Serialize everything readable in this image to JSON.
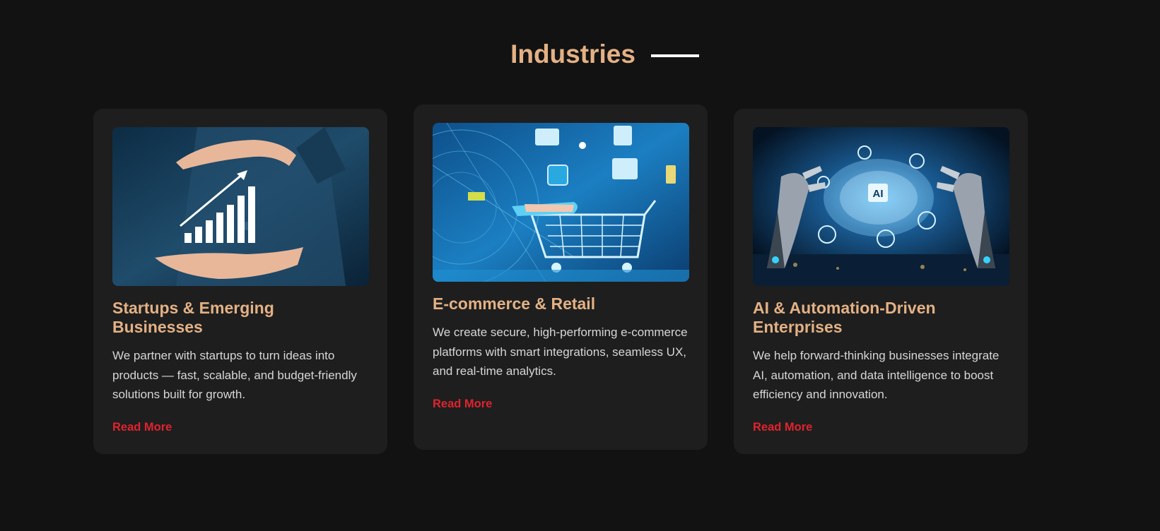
{
  "section": {
    "title": "Industries"
  },
  "cards": [
    {
      "title": "Startups & Emerging Businesses",
      "description": "We partner with startups to turn ideas into products — fast, scalable, and budget-friendly solutions built for growth.",
      "link": "Read More",
      "image_icon": "growth-chart-hands-image"
    },
    {
      "title": "E-commerce & Retail",
      "description": "We create secure, high-performing e-commerce platforms with smart integrations, seamless UX, and real-time analytics.",
      "link": "Read More",
      "image_icon": "shopping-cart-digital-image"
    },
    {
      "title": "AI & Automation-Driven Enterprises",
      "description": "We help forward-thinking businesses integrate AI, automation, and data intelligence to boost efficiency and innovation.",
      "link": "Read More",
      "image_icon": "robot-hands-ai-brain-image",
      "image_label": "AI"
    }
  ],
  "colors": {
    "background": "#121212",
    "card": "#1e1e1e",
    "accent": "#e3b185",
    "link": "#e0232e",
    "text": "#d6d6d6"
  }
}
